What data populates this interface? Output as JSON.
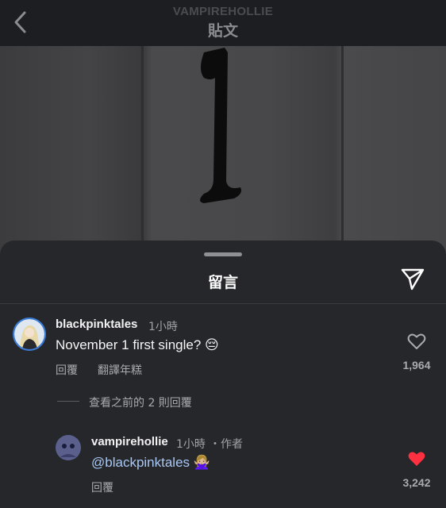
{
  "header": {
    "username": "VAMPIREHOLLIE",
    "title": "貼文"
  },
  "sheet": {
    "title": "留言"
  },
  "comments": [
    {
      "username": "blackpinktales",
      "time": "1小時",
      "text": "November 1 first single? 😔",
      "actions": [
        "回覆",
        "翻譯年糕"
      ],
      "likes": "1,964",
      "liked": false
    }
  ],
  "view_replies": "查看之前的 2 則回覆",
  "reply": {
    "username": "vampirehollie",
    "time": "1小時",
    "author_tag": "・作者",
    "mention": "@blackpinktales",
    "emoji": "🙅🏼‍♀️",
    "action": "回覆",
    "likes": "3,242",
    "liked": true
  },
  "colors": {
    "sheet_bg": "#25272b",
    "topbar_bg": "#1c1e21",
    "mention": "#a8c8f5",
    "heart_liked": "#ff3040"
  }
}
